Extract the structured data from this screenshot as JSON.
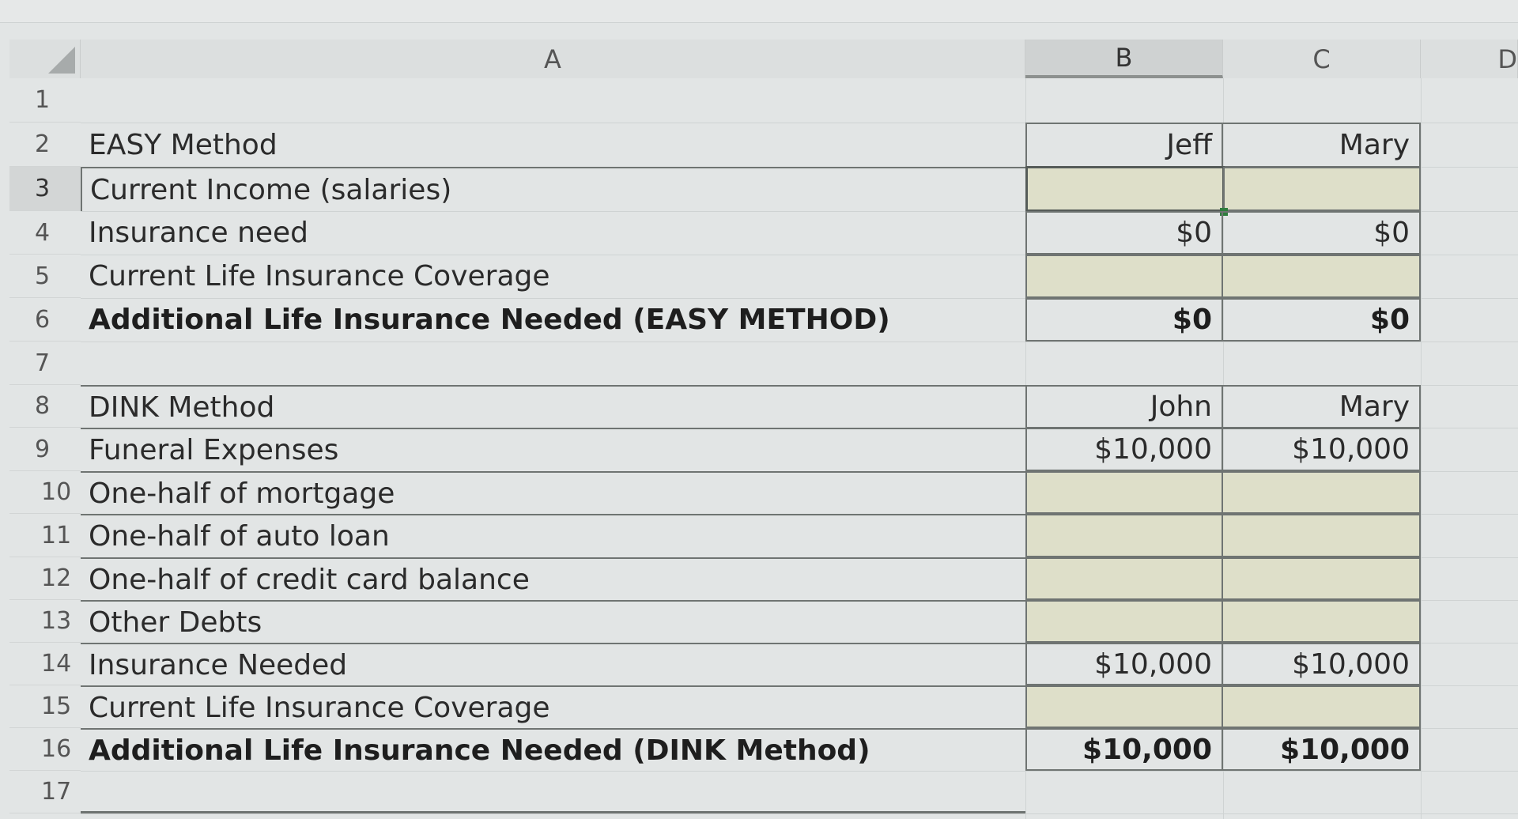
{
  "columns": {
    "a": "A",
    "b": "B",
    "c": "C",
    "d": "D"
  },
  "rows": [
    "1",
    "2",
    "3",
    "4",
    "5",
    "6",
    "7",
    "8",
    "9",
    "10",
    "11",
    "12",
    "13",
    "14",
    "15",
    "16",
    "17"
  ],
  "easy": {
    "title": "EASY Method",
    "person1": "Jeff",
    "person2": "Mary",
    "income_label": "Current Income (salaries)",
    "need_label": "Insurance need",
    "need_p1": "$0",
    "need_p2": "$0",
    "coverage_label": "Current Life Insurance Coverage",
    "additional_label": "Additional Life Insurance Needed (EASY METHOD)",
    "additional_p1": "$0",
    "additional_p2": "$0"
  },
  "dink": {
    "title": "DINK Method",
    "person1": "John",
    "person2": "Mary",
    "funeral_label": "Funeral Expenses",
    "funeral_p1": "$10,000",
    "funeral_p2": "$10,000",
    "mortgage_label": "One-half of mortgage",
    "auto_label": "One-half of auto loan",
    "credit_label": "One-half of credit card balance",
    "other_label": "Other Debts",
    "needed_label": "Insurance Needed",
    "needed_p1": "$10,000",
    "needed_p2": "$10,000",
    "coverage_label": "Current Life Insurance Coverage",
    "additional_label": "Additional Life Insurance Needed (DINK Method)",
    "additional_p1": "$10,000",
    "additional_p2": "$10,000"
  },
  "colors": {
    "input_fill": "#dedfc9",
    "selection_border": "#555b58",
    "fill_handle": "#2f7d3e"
  }
}
